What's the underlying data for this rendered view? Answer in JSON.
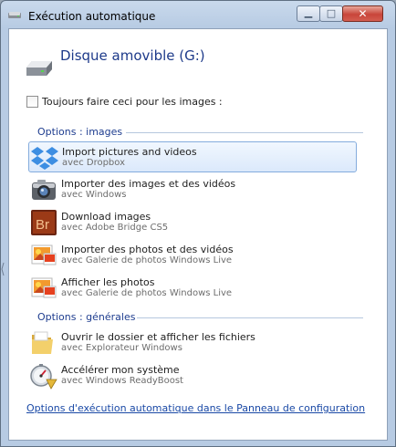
{
  "window": {
    "title": "Exécution automatique"
  },
  "header": {
    "device_name": "Disque amovible (G:)"
  },
  "always_checkbox": {
    "label": "Toujours faire ceci pour les images :",
    "checked": false
  },
  "groups": {
    "images": {
      "header": "Options : images"
    },
    "general": {
      "header": "Options : générales"
    }
  },
  "options": [
    {
      "title": "Import pictures and videos",
      "subtitle": "avec Dropbox",
      "icon": "dropbox-icon",
      "selected": true
    },
    {
      "title": "Importer des images et des vidéos",
      "subtitle": "avec Windows",
      "icon": "camera-icon",
      "selected": false
    },
    {
      "title": "Download images",
      "subtitle": "avec Adobe Bridge CS5",
      "icon": "adobe-bridge-icon",
      "selected": false
    },
    {
      "title": "Importer des photos et des vidéos",
      "subtitle": "avec Galerie de photos Windows Live",
      "icon": "photo-gallery-icon",
      "selected": false
    },
    {
      "title": "Afficher les photos",
      "subtitle": "avec Galerie de photos Windows Live",
      "icon": "photo-gallery-icon",
      "selected": false
    },
    {
      "title": "Ouvrir le dossier et afficher les fichiers",
      "subtitle": "avec Explorateur Windows",
      "icon": "folder-icon",
      "selected": false
    },
    {
      "title": "Accélérer mon système",
      "subtitle": "avec Windows ReadyBoost",
      "icon": "readyboost-icon",
      "selected": false
    }
  ],
  "footer": {
    "control_panel_link": "Options d'exécution automatique dans le Panneau de configuration"
  },
  "colors": {
    "accent": "#1e3d8f",
    "link": "#1a49a6",
    "selection": "#dbe9fb"
  }
}
